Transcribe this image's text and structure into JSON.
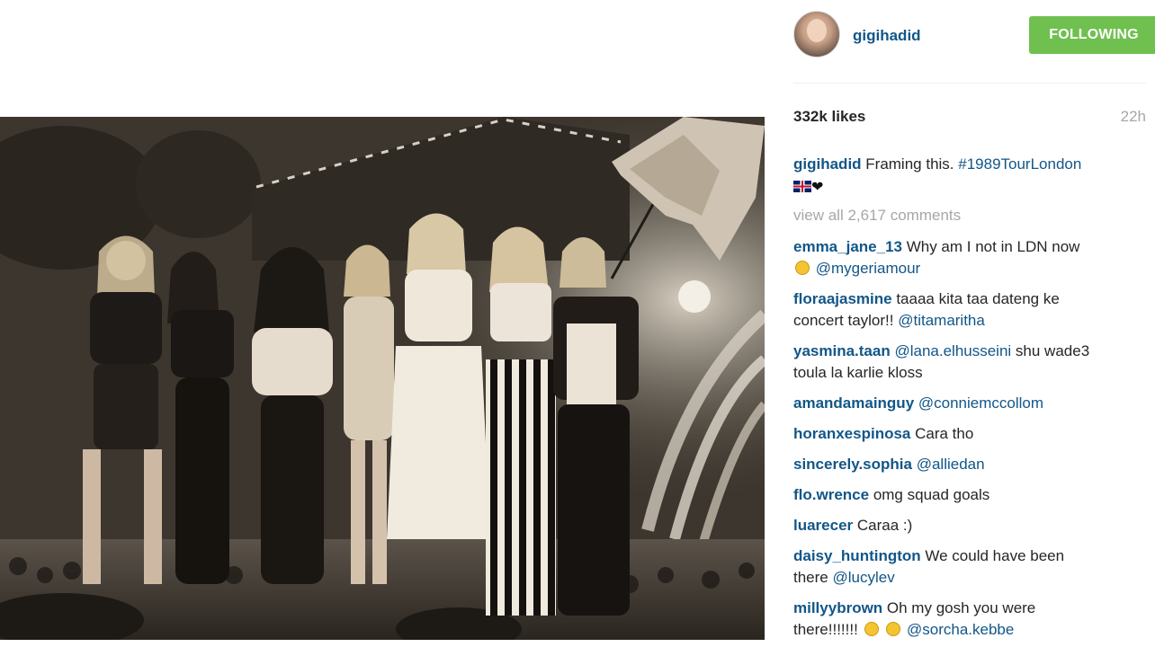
{
  "post": {
    "username": "gigihadid",
    "follow_label": "FOLLOWING",
    "likes": "332k likes",
    "age": "22h",
    "caption": {
      "user": "gigihadid",
      "text": " Framing this. ",
      "hashtag": "#1989TourLondon"
    },
    "view_all": "view all 2,617 comments"
  },
  "comments": [
    {
      "user": "emma_jane_13",
      "text": " Why am I not in LDN now",
      "line2": "",
      "mention": "@mygeriamour"
    },
    {
      "user": "floraajasmine",
      "text": " taaaa kita taa dateng ke",
      "line2": "concert taylor!! ",
      "mention": "@titamaritha"
    },
    {
      "user": "yasmina.taan",
      "mention": "@lana.elhusseini",
      "text": " shu wade3",
      "line2": "toula la karlie kloss"
    },
    {
      "user": "amandamainguy",
      "mention": "@conniemccollom"
    },
    {
      "user": "horanxespinosa",
      "text": " Cara tho"
    },
    {
      "user": "sincerely.sophia",
      "mention": "@alliedan"
    },
    {
      "user": "flo.wrence",
      "text": " omg squad goals"
    },
    {
      "user": "luarecer",
      "text": " Caraa :)"
    },
    {
      "user": "daisy_huntington",
      "text": " We could have been",
      "line2": "there ",
      "mention": "@lucylev"
    },
    {
      "user": "millyybrown",
      "text": " Oh my gosh you were",
      "line2": "there!!!!!!! ",
      "mention": "@sorcha.kebbe"
    }
  ],
  "icons": {
    "flag": "uk-flag-icon",
    "heart": "black-heart-icon",
    "sad_face": "disappointed-face-icon",
    "scream_face": "screaming-face-icon"
  },
  "colors": {
    "username": "#125688",
    "follow_button": "#70c050",
    "muted": "#a5a7aa"
  }
}
